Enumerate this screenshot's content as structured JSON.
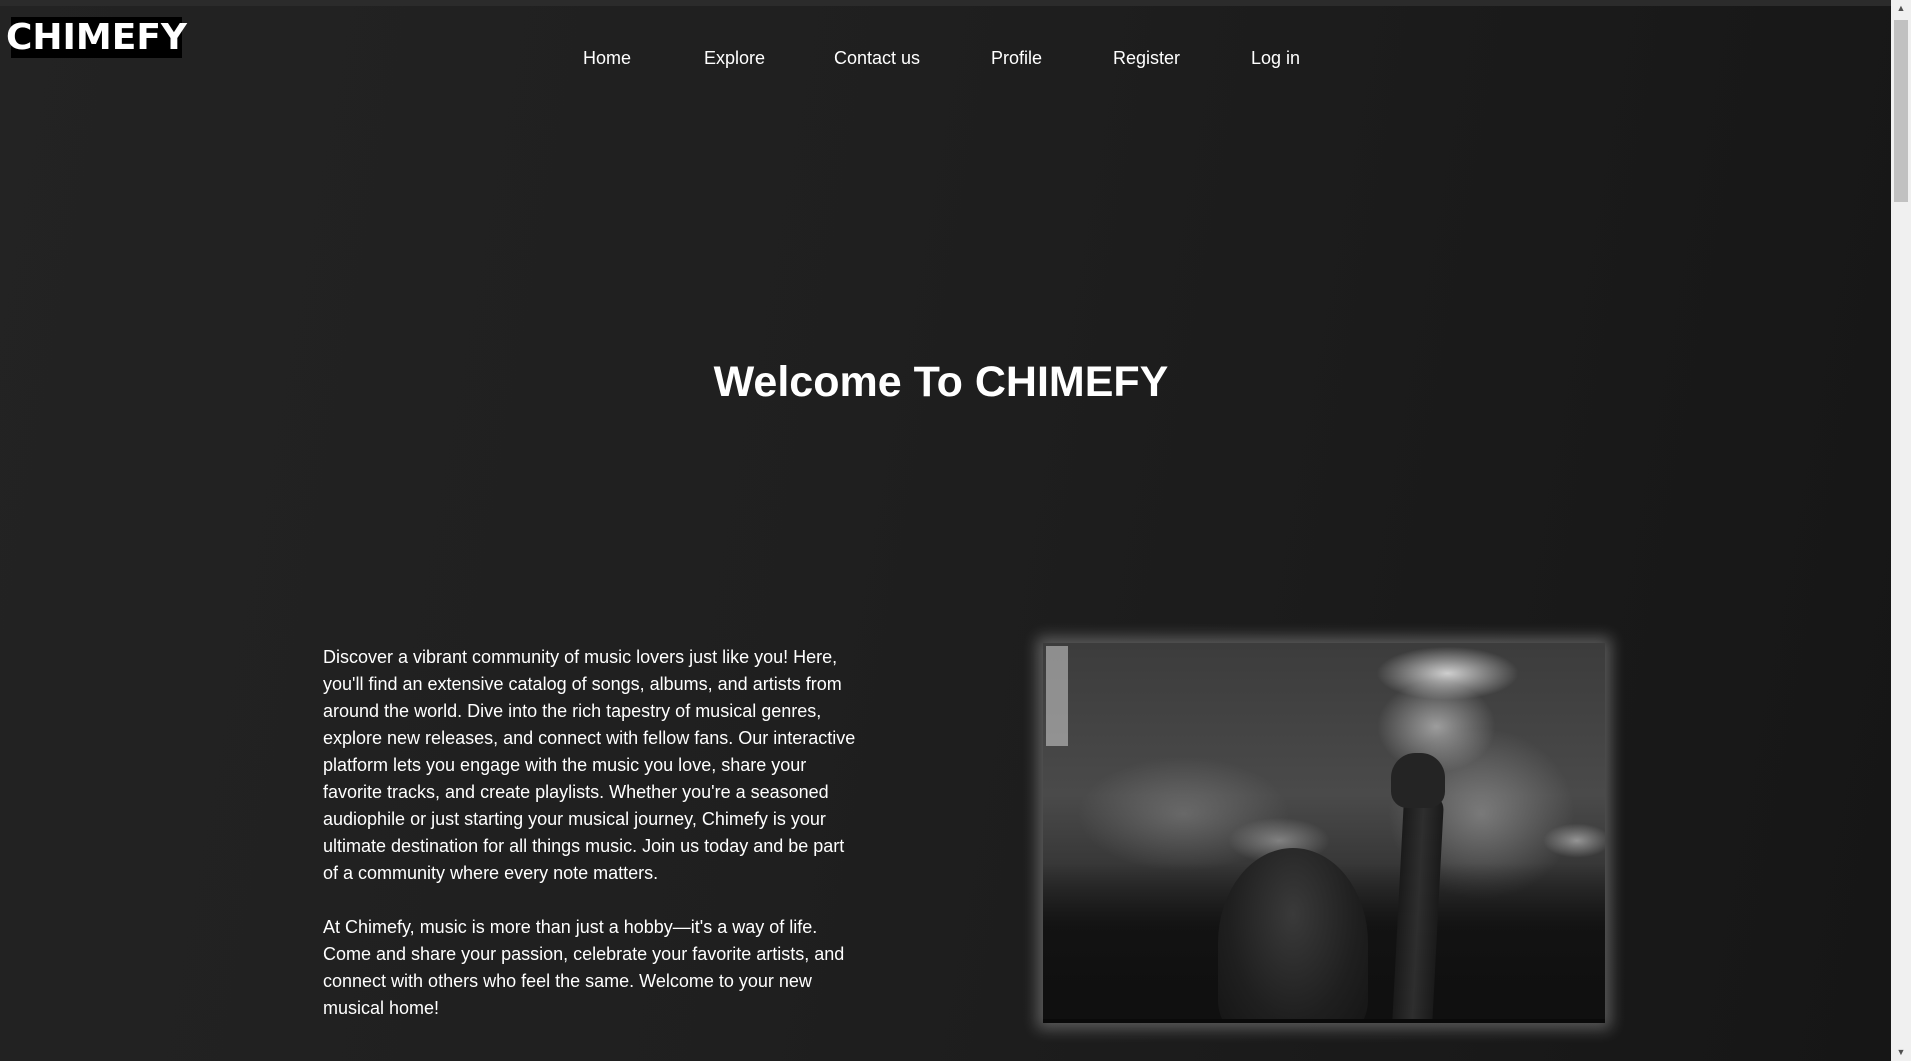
{
  "brand": {
    "logo_text": "CHIMEFY"
  },
  "nav": {
    "items": [
      {
        "label": "Home"
      },
      {
        "label": "Explore"
      },
      {
        "label": "Contact us"
      },
      {
        "label": "Profile"
      },
      {
        "label": "Register"
      },
      {
        "label": "Log in"
      }
    ]
  },
  "hero": {
    "title": "Welcome To CHIMEFY"
  },
  "intro": {
    "paragraphs": [
      "Discover a vibrant community of music lovers just like you! Here, you'll find an extensive catalog of songs, albums, and artists from around the world. Dive into the rich tapestry of musical genres, explore new releases, and connect with fellow fans. Our interactive platform lets you engage with the music you love, share your favorite tracks, and create playlists. Whether you're a seasoned audiophile or just starting your musical journey, Chimefy is your ultimate destination for all things music. Join us today and be part of a community where every note matters.",
      "At Chimefy, music is more than just a hobby—it's a way of life. Come and share your passion, celebrate your favorite artists, and connect with others who feel the same. Welcome to your new musical home!"
    ]
  },
  "photo": {
    "subject": "concert-crowd-photo"
  },
  "colors": {
    "background": "#1a1a1a",
    "text": "#ffffff",
    "logo_background": "#000000"
  }
}
